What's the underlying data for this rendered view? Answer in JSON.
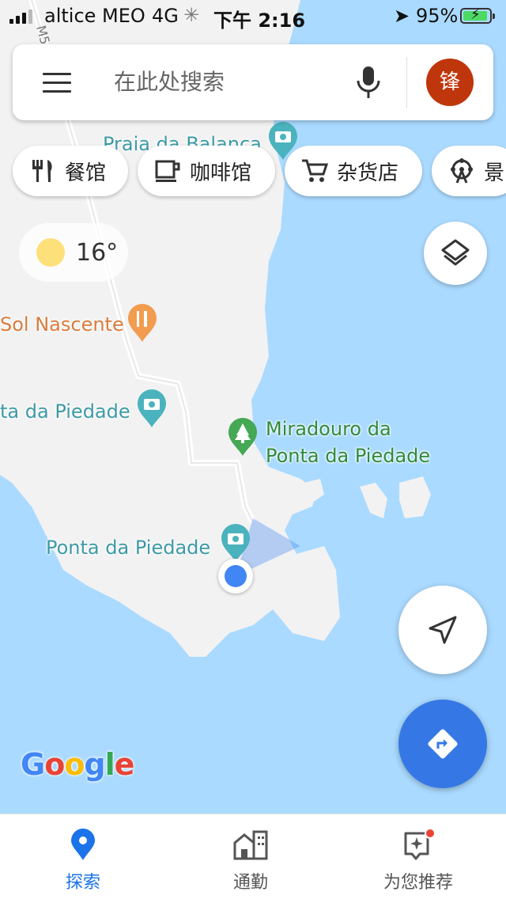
{
  "status_bar": {
    "carrier": "altice MEO",
    "network": "4G",
    "time": "下午 2:16",
    "battery": "95%",
    "battery_level": 0.95
  },
  "search": {
    "placeholder": "在此处搜索",
    "avatar_initial": "锋"
  },
  "chips": [
    {
      "label": "餐馆",
      "icon": "restaurant-icon"
    },
    {
      "label": "咖啡馆",
      "icon": "coffee-icon"
    },
    {
      "label": "杂货店",
      "icon": "cart-icon"
    },
    {
      "label": "景",
      "icon": "ferris-wheel-icon"
    }
  ],
  "weather": {
    "temp": "16°",
    "icon": "sun-icon"
  },
  "map": {
    "labels": {
      "praia": "Praia da Balanca",
      "sol": "Sol Nascente",
      "ponta_cut": "ta da Piedade",
      "miradouro_1": "Miradouro da",
      "miradouro_2": "Ponta da Piedade",
      "ponta": "Ponta da Piedade"
    },
    "road_label": "M5",
    "logo": [
      "G",
      "o",
      "o",
      "g",
      "l",
      "e"
    ]
  },
  "colors": {
    "water": "#aadaff",
    "land": "#f2f2f2",
    "accent": "#1a73e8",
    "directions": "#3578e5",
    "avatar": "#bf360c"
  },
  "nav": [
    {
      "label": "探索",
      "icon": "explore-pin-icon",
      "active": true
    },
    {
      "label": "通勤",
      "icon": "commute-icon",
      "active": false
    },
    {
      "label": "为您推荐",
      "icon": "for-you-icon",
      "active": false
    }
  ]
}
